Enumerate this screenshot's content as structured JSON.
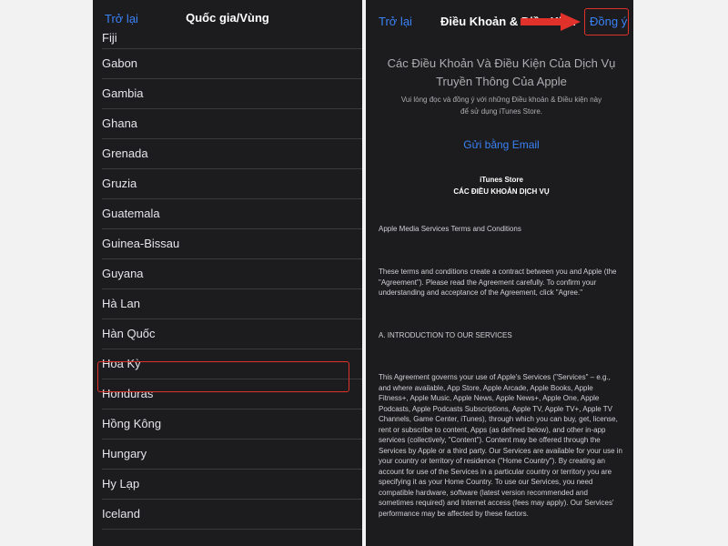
{
  "left": {
    "back_label": "Trở lại",
    "title": "Quốc gia/Vùng",
    "countries": [
      "Fiji",
      "Gabon",
      "Gambia",
      "Ghana",
      "Grenada",
      "Gruzia",
      "Guatemala",
      "Guinea-Bissau",
      "Guyana",
      "Hà Lan",
      "Hàn Quốc",
      "Hoa Kỳ",
      "Honduras",
      "Hồng Kông",
      "Hungary",
      "Hy Lạp",
      "Iceland"
    ],
    "selected": "Hoa Kỳ"
  },
  "right": {
    "back_label": "Trở lại",
    "title": "Điều Khoản & Điều Kiện",
    "agree_label": "Đồng ý",
    "heading_line1": "Các Điều Khoản Và Điều Kiện Của Dịch Vụ",
    "heading_line2": "Truyền Thông Của Apple",
    "sub_line1": "Vui lòng đọc và đồng ý với những Điều khoản & Điều kiện này",
    "sub_line2": "để sử dụng iTunes Store.",
    "email_label": "Gửi bằng Email",
    "store_name": "iTunes Store",
    "store_terms": "CÁC ĐIỀU KHOẢN DỊCH VỤ",
    "para1": "Apple Media Services Terms and Conditions",
    "para2": "These terms and conditions create a contract between you and Apple (the \"Agreement\"). Please read the Agreement carefully. To confirm your understanding and acceptance of the Agreement, click \"Agree.\"",
    "para3": "A. INTRODUCTION TO OUR SERVICES",
    "para4": "This Agreement governs your use of Apple's Services (\"Services\" – e.g., and where available, App Store, Apple Arcade, Apple Books, Apple Fitness+, Apple Music, Apple News, Apple News+, Apple One, Apple Podcasts, Apple Podcasts Subscriptions, Apple TV, Apple TV+, Apple TV Channels, Game Center, iTunes), through which you can buy, get, license, rent or subscribe to content, Apps (as defined below), and other in-app services (collectively, \"Content\"). Content may be offered through the Services by Apple or a third party. Our Services are available for your use in your country or territory of residence (\"Home Country\"). By creating an account for use of the Services in a particular country or territory you are specifying it as your Home Country. To use our Services, you need compatible hardware, software (latest version recommended and sometimes required) and Internet access (fees may apply). Our Services' performance may be affected by these factors."
  },
  "colors": {
    "background": "#1c1c1e",
    "accent": "#3a82f7",
    "highlight": "#e0312b"
  }
}
